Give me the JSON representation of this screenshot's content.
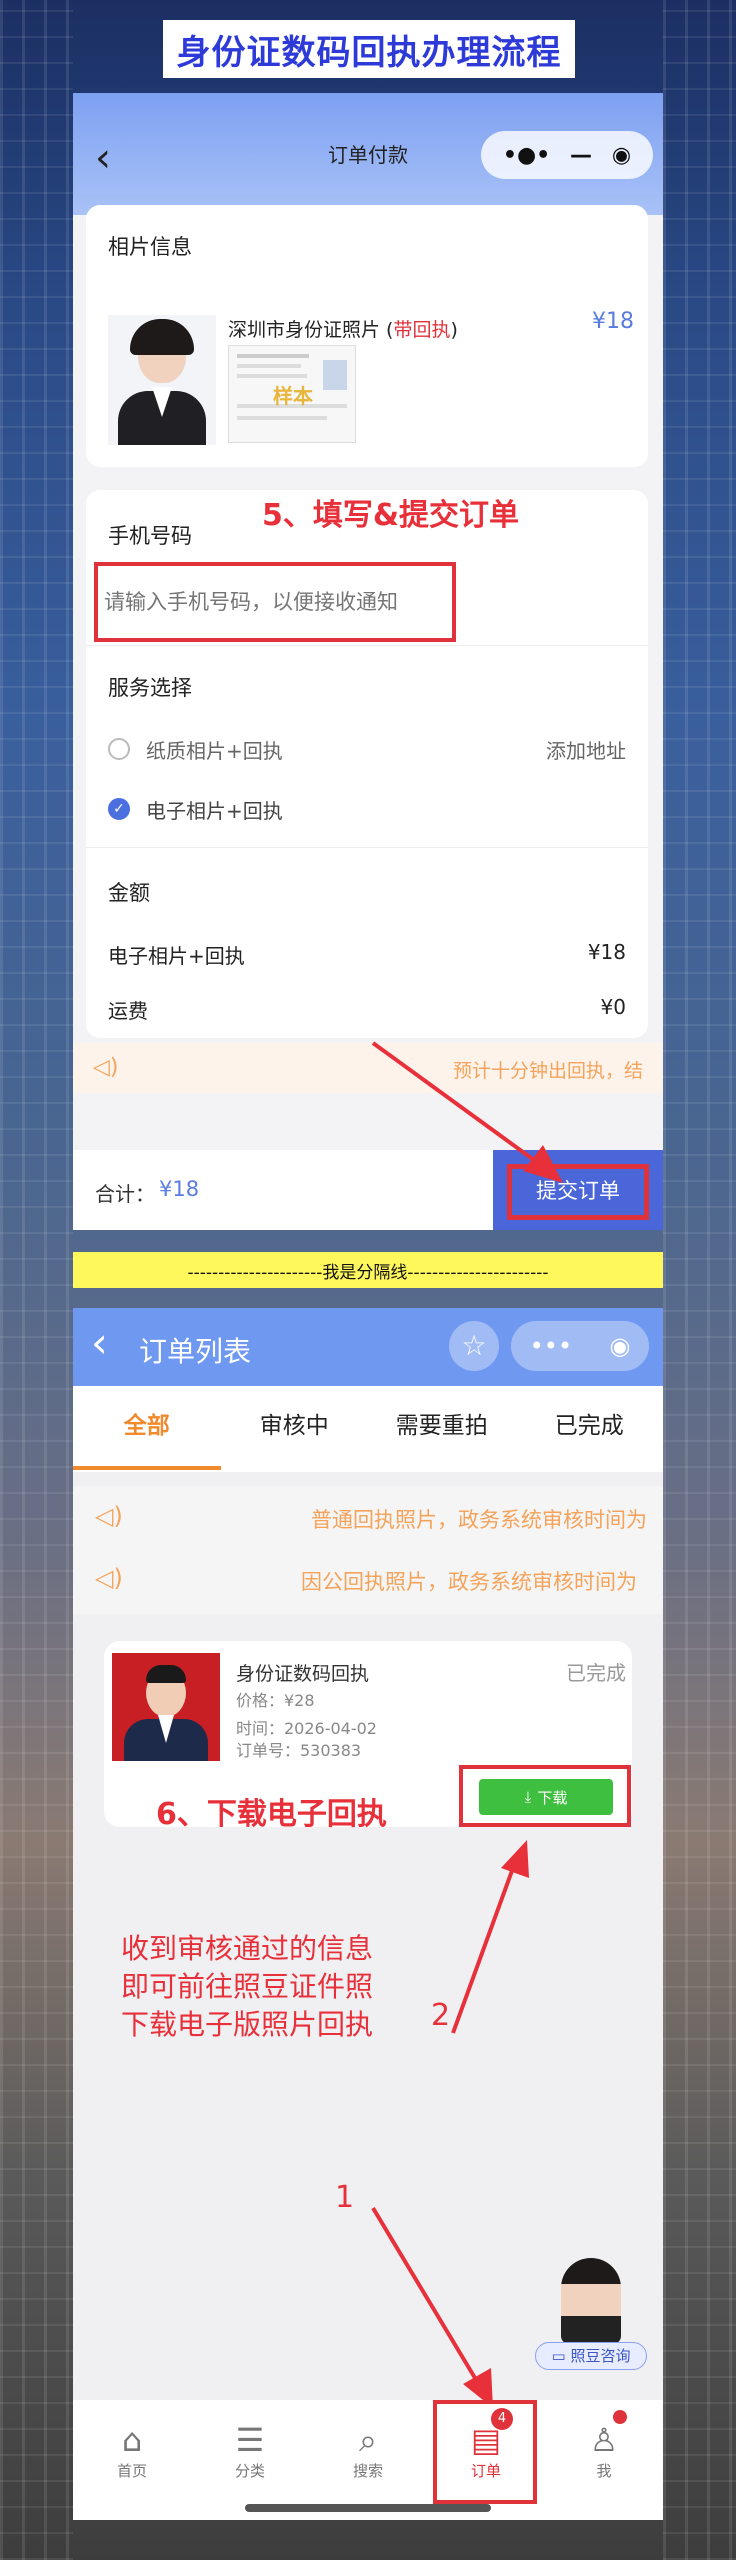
{
  "banner": {
    "title": "身份证数码回执办理流程"
  },
  "order_page": {
    "nav_title": "订单付款",
    "photo_section_title": "相片信息",
    "product_name_prefix": "深圳市身份证照片 (",
    "product_name_highlight": "带回执",
    "product_name_suffix": ")",
    "product_price": "¥18",
    "sample_stamp": "样本",
    "phone_label": "手机号码",
    "phone_placeholder": "请输入手机号码，以便接收通知",
    "annotation_step5": "5、填写&提交订单",
    "service_label": "服务选择",
    "option_paper": "纸质相片+回执",
    "add_address": "添加地址",
    "option_electronic": "电子相片+回执",
    "amount_label": "金额",
    "amount_item": "电子相片+回执",
    "amount_item_price": "¥18",
    "shipping_label": "运费",
    "shipping_price": "¥0",
    "notice": "预计十分钟出回执，结",
    "total_label": "合计：",
    "total_value": "¥18",
    "submit_label": "提交订单"
  },
  "divider": {
    "text": "----------------------我是分隔线-----------------------"
  },
  "orders_page": {
    "nav_title": "订单列表",
    "tabs": [
      "全部",
      "审核中",
      "需要重拍",
      "已完成"
    ],
    "notice1": "普通回执照片，政务系统审核时间为",
    "notice2": "因公回执照片，政务系统审核时间为",
    "order": {
      "title": "身份证数码回执",
      "status": "已完成",
      "price": "价格：¥28",
      "time": "时间：2026-04-02",
      "order_no": "订单号：530383",
      "download_label": "下载"
    },
    "annotation_step6": "6、下载电子回执",
    "annotation_text_line1": "收到审核通过的信息",
    "annotation_text_line2": "即可前往照豆证件照",
    "annotation_text_line3": "下载电子版照片回执",
    "marker_1": "1",
    "marker_2": "2",
    "consult_label": "照豆咨询",
    "tabbar": [
      {
        "label": "首页",
        "icon": "home-icon"
      },
      {
        "label": "分类",
        "icon": "category-icon"
      },
      {
        "label": "搜索",
        "icon": "search-icon"
      },
      {
        "label": "订单",
        "icon": "order-icon",
        "badge": "4"
      },
      {
        "label": "我",
        "icon": "user-icon"
      }
    ]
  },
  "colors": {
    "accent_blue": "#4a66d8",
    "annotation_red": "#e0323a",
    "active_orange": "#f08a2c",
    "download_green": "#3fbf3f"
  }
}
